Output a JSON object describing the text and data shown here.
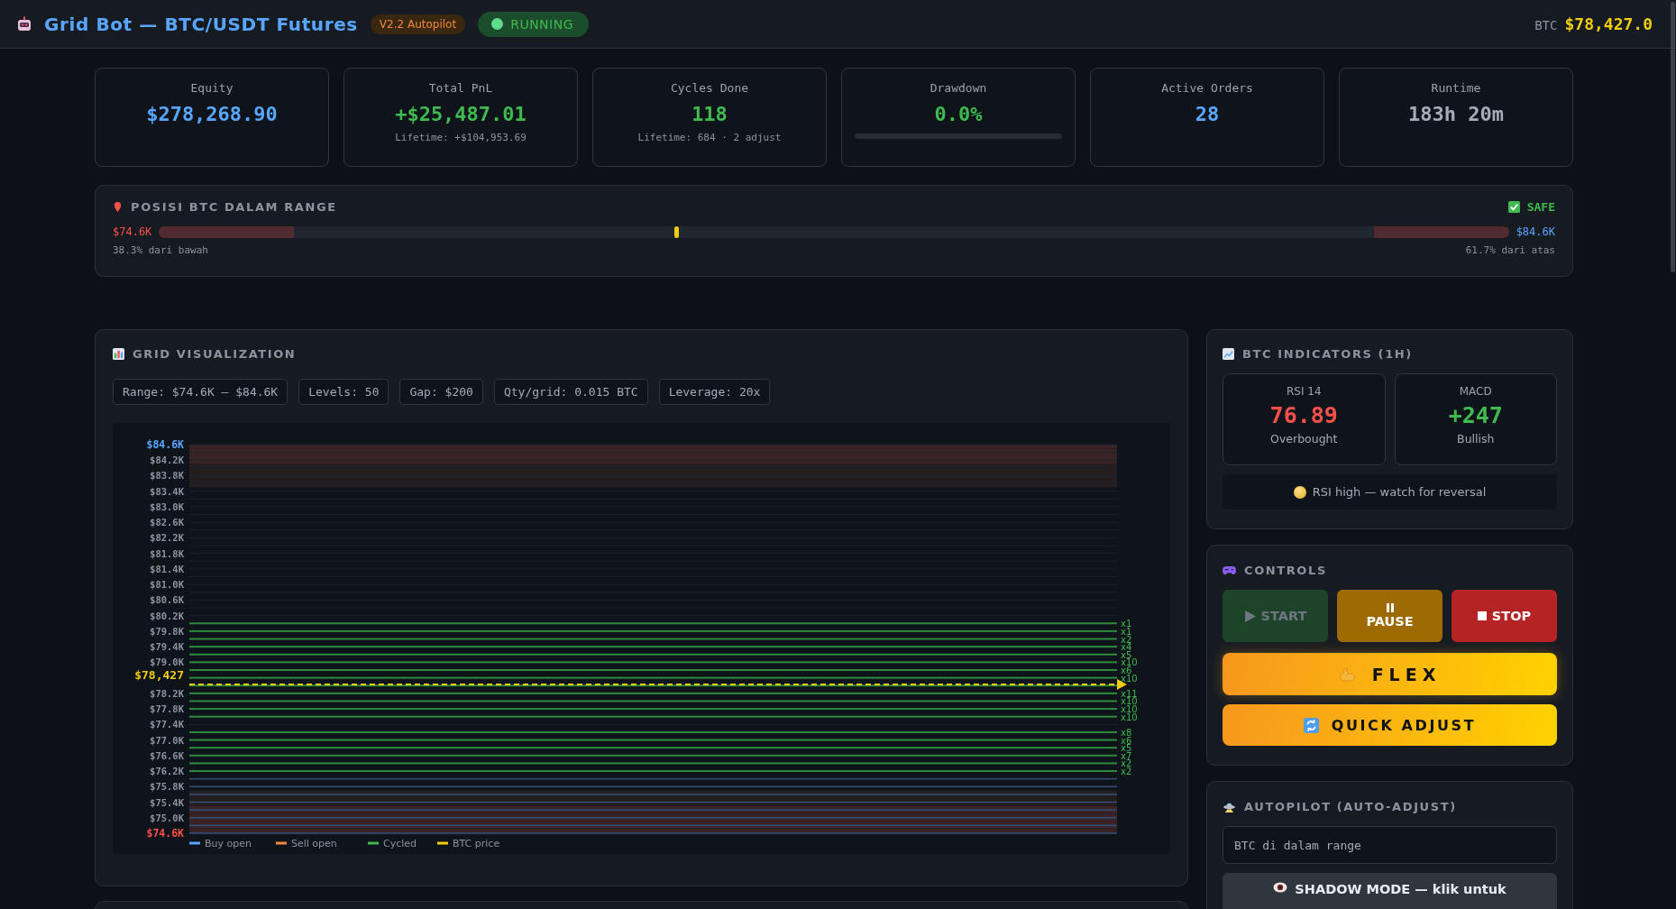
{
  "header": {
    "title": "Grid Bot — BTC/USDT Futures",
    "version_badge": "V2.2 Autopilot",
    "status": {
      "label": "RUNNING",
      "running": true
    },
    "price_label": "BTC",
    "price": "$78,427.0"
  },
  "stats": [
    {
      "kind": "plain",
      "label": "Equity",
      "value": "$278,268.90",
      "color": "#58a6ff"
    },
    {
      "kind": "plain",
      "label": "Total PnL",
      "value": "+$25,487.01",
      "color": "#3fb950",
      "note": "Lifetime: +$104,953.69"
    },
    {
      "kind": "plain",
      "label": "Cycles Done",
      "value": "118",
      "color": "#3fb950",
      "note": "Lifetime: 684 · 2 adjust"
    },
    {
      "kind": "meter",
      "label": "Drawdown",
      "value": "0.0%",
      "color": "#3fb950"
    },
    {
      "kind": "plain",
      "label": "Active Orders",
      "value": "28",
      "color": "#58a6ff"
    },
    {
      "kind": "plain",
      "label": "Runtime",
      "value": "183h 20m",
      "color": "#a3acb7"
    }
  ],
  "range_position": {
    "title": "POSISI BTC DALAM RANGE",
    "safe_label": "SAFE",
    "low": "$74.6K",
    "high": "$84.6K",
    "level": 0.383,
    "from_bottom": "38.3% dari bawah",
    "from_top": "61.7% dari atas"
  },
  "grid": {
    "title": "GRID VISUALIZATION",
    "params": [
      "Range: $74.6K – $84.6K",
      "Levels: 50",
      "Gap: $200",
      "Qty/grid: 0.015 BTC",
      "Leverage: 20x"
    ],
    "chart": {
      "price_label": "$78,427",
      "levels": [
        {
          "kind": "idle",
          "tick": {
            "label": "$84.6K",
            "color": "#58a6ff"
          },
          "danger": true,
          "caution": false
        },
        {
          "kind": "idle",
          "danger": true,
          "caution": false
        },
        {
          "kind": "idle",
          "tick": {
            "label": "$84.2K"
          },
          "danger": true,
          "caution": false
        },
        {
          "kind": "idle",
          "danger": false,
          "caution": true
        },
        {
          "kind": "idle",
          "tick": {
            "label": "$83.8K"
          },
          "danger": false,
          "caution": true
        },
        {
          "kind": "idle",
          "danger": false,
          "caution": true
        },
        {
          "kind": "idle",
          "tick": {
            "label": "$83.4K"
          },
          "danger": false,
          "caution": false
        },
        {
          "kind": "idle",
          "danger": false,
          "caution": false
        },
        {
          "kind": "idle",
          "tick": {
            "label": "$83.0K"
          },
          "danger": false,
          "caution": false
        },
        {
          "kind": "idle",
          "danger": false,
          "caution": false
        },
        {
          "kind": "idle",
          "tick": {
            "label": "$82.6K"
          },
          "danger": false,
          "caution": false
        },
        {
          "kind": "idle",
          "danger": false,
          "caution": false
        },
        {
          "kind": "idle",
          "tick": {
            "label": "$82.2K"
          },
          "danger": false,
          "caution": false
        },
        {
          "kind": "idle",
          "danger": false,
          "caution": false
        },
        {
          "kind": "idle",
          "tick": {
            "label": "$81.8K"
          },
          "danger": false,
          "caution": false
        },
        {
          "kind": "idle",
          "danger": false,
          "caution": false
        },
        {
          "kind": "idle",
          "tick": {
            "label": "$81.4K"
          },
          "danger": false,
          "caution": false
        },
        {
          "kind": "idle",
          "danger": false,
          "caution": false
        },
        {
          "kind": "idle",
          "tick": {
            "label": "$81.0K"
          },
          "danger": false,
          "caution": false
        },
        {
          "kind": "idle",
          "danger": false,
          "caution": false
        },
        {
          "kind": "idle",
          "tick": {
            "label": "$80.6K"
          },
          "danger": false,
          "caution": false
        },
        {
          "kind": "idle",
          "danger": false,
          "caution": false
        },
        {
          "kind": "idle",
          "tick": {
            "label": "$80.2K"
          },
          "danger": false,
          "caution": false
        },
        {
          "kind": "cycled",
          "cycles": "x1",
          "danger": false,
          "caution": false
        },
        {
          "kind": "cycled",
          "tick": {
            "label": "$79.8K"
          },
          "cycles": "x1",
          "danger": false,
          "caution": false
        },
        {
          "kind": "cycled",
          "cycles": "x2",
          "danger": false,
          "caution": false
        },
        {
          "kind": "cycled",
          "tick": {
            "label": "$79.4K"
          },
          "cycles": "x4",
          "danger": false,
          "caution": false
        },
        {
          "kind": "cycled",
          "cycles": "x5",
          "danger": false,
          "caution": false
        },
        {
          "kind": "cycled",
          "tick": {
            "label": "$79.0K"
          },
          "cycles": "x10",
          "danger": false,
          "caution": false
        },
        {
          "kind": "cycled",
          "cycles": "x6",
          "danger": false,
          "caution": false
        },
        {
          "kind": "cycled",
          "cycles": "x10",
          "danger": false,
          "caution": false
        },
        {
          "kind": "cycled",
          "danger": false,
          "caution": false
        },
        {
          "kind": "cycled",
          "tick": {
            "label": "$78.2K"
          },
          "cycles": "x11",
          "danger": false,
          "caution": false
        },
        {
          "kind": "cycled",
          "cycles": "x10",
          "danger": false,
          "caution": false
        },
        {
          "kind": "cycled",
          "tick": {
            "label": "$77.8K"
          },
          "cycles": "x10",
          "danger": false,
          "caution": false
        },
        {
          "kind": "cycled",
          "cycles": "x10",
          "danger": false,
          "caution": false
        },
        {
          "kind": "idle",
          "tick": {
            "label": "$77.4K"
          },
          "danger": false,
          "caution": false
        },
        {
          "kind": "cycled",
          "cycles": "x8",
          "danger": false,
          "caution": false
        },
        {
          "kind": "cycled",
          "tick": {
            "label": "$77.0K"
          },
          "cycles": "x6",
          "danger": false,
          "caution": false
        },
        {
          "kind": "cycled",
          "cycles": "x5",
          "danger": false,
          "caution": false
        },
        {
          "kind": "cycled",
          "tick": {
            "label": "$76.6K"
          },
          "cycles": "x7",
          "danger": false,
          "caution": false
        },
        {
          "kind": "cycled",
          "cycles": "x2",
          "danger": false,
          "caution": false
        },
        {
          "kind": "cycled",
          "tick": {
            "label": "$76.2K"
          },
          "cycles": "x2",
          "danger": false,
          "caution": false
        },
        {
          "kind": "buy",
          "danger": false,
          "caution": false
        },
        {
          "kind": "buy",
          "tick": {
            "label": "$75.8K"
          },
          "danger": false,
          "caution": false
        },
        {
          "kind": "buy",
          "danger": false,
          "caution": true
        },
        {
          "kind": "buy",
          "tick": {
            "label": "$75.4K"
          },
          "danger": false,
          "caution": true
        },
        {
          "kind": "buy",
          "danger": true,
          "caution": false
        },
        {
          "kind": "buy",
          "tick": {
            "label": "$75.0K"
          },
          "danger": true,
          "caution": false
        },
        {
          "kind": "buy",
          "danger": true,
          "caution": false
        },
        {
          "kind": "buy",
          "tick": {
            "label": "$74.6K",
            "color": "#f85149"
          },
          "danger": true,
          "caution": false
        }
      ],
      "legend": [
        {
          "label": "Buy open",
          "color": "#58a6ff"
        },
        {
          "label": "Sell open",
          "color": "#f0883e"
        },
        {
          "label": "Cycled",
          "color": "#3fb950"
        },
        {
          "label": "BTC price",
          "color": "#f2cc0f"
        }
      ]
    }
  },
  "indicators": {
    "title": "BTC INDICATORS (1H)",
    "cards": [
      {
        "label": "RSI 14",
        "value": "76.89",
        "color": "#f85149",
        "note": "Overbought"
      },
      {
        "label": "MACD",
        "value": "+247",
        "color": "#3fb950",
        "note": "Bullish"
      }
    ],
    "alert": "RSI high — watch for reversal"
  },
  "controls": {
    "title": "CONTROLS",
    "buttons": [
      {
        "kind": "start",
        "label": "START",
        "disabled": true
      },
      {
        "kind": "pause",
        "label": "PAUSE",
        "disabled": false
      },
      {
        "kind": "stop",
        "label": "STOP",
        "disabled": false
      }
    ],
    "actions": [
      {
        "kind": "flex",
        "label": "FLEX"
      },
      {
        "kind": "adjust",
        "label": "QUICK ADJUST"
      }
    ]
  },
  "autopilot": {
    "title": "AUTOPILOT (AUTO-ADJUST)",
    "status_text": "BTC di dalam range",
    "shadow_button": "SHADOW MODE — klik untuk"
  }
}
